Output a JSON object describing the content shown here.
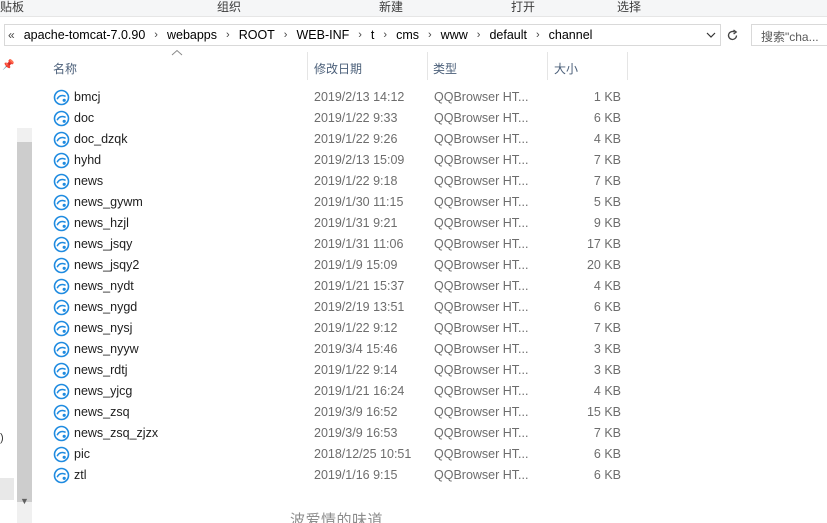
{
  "ribbon": {
    "groups": [
      "贴板",
      "组织",
      "新建",
      "打开",
      "选择"
    ]
  },
  "address": {
    "lead": "«",
    "crumbs": [
      "apache-tomcat-7.0.90",
      "webapps",
      "ROOT",
      "WEB-INF",
      "t",
      "cms",
      "www",
      "default",
      "channel"
    ]
  },
  "search": {
    "placeholder": "搜索\"cha..."
  },
  "nav": {
    "fragment": ")"
  },
  "columns": {
    "name": "名称",
    "date": "修改日期",
    "type": "类型",
    "size": "大小"
  },
  "files": [
    {
      "name": "bmcj",
      "date": "2019/2/13 14:12",
      "type": "QQBrowser HT...",
      "size": "1 KB"
    },
    {
      "name": "doc",
      "date": "2019/1/22 9:33",
      "type": "QQBrowser HT...",
      "size": "6 KB"
    },
    {
      "name": "doc_dzqk",
      "date": "2019/1/22 9:26",
      "type": "QQBrowser HT...",
      "size": "4 KB"
    },
    {
      "name": "hyhd",
      "date": "2019/2/13 15:09",
      "type": "QQBrowser HT...",
      "size": "7 KB"
    },
    {
      "name": "news",
      "date": "2019/1/22 9:18",
      "type": "QQBrowser HT...",
      "size": "7 KB"
    },
    {
      "name": "news_gywm",
      "date": "2019/1/30 11:15",
      "type": "QQBrowser HT...",
      "size": "5 KB"
    },
    {
      "name": "news_hzjl",
      "date": "2019/1/31 9:21",
      "type": "QQBrowser HT...",
      "size": "9 KB"
    },
    {
      "name": "news_jsqy",
      "date": "2019/1/31 11:06",
      "type": "QQBrowser HT...",
      "size": "17 KB"
    },
    {
      "name": "news_jsqy2",
      "date": "2019/1/9 15:09",
      "type": "QQBrowser HT...",
      "size": "20 KB"
    },
    {
      "name": "news_nydt",
      "date": "2019/1/21 15:37",
      "type": "QQBrowser HT...",
      "size": "4 KB"
    },
    {
      "name": "news_nygd",
      "date": "2019/2/19 13:51",
      "type": "QQBrowser HT...",
      "size": "6 KB"
    },
    {
      "name": "news_nysj",
      "date": "2019/1/22 9:12",
      "type": "QQBrowser HT...",
      "size": "7 KB"
    },
    {
      "name": "news_nyyw",
      "date": "2019/3/4 15:46",
      "type": "QQBrowser HT...",
      "size": "3 KB"
    },
    {
      "name": "news_rdtj",
      "date": "2019/1/22 9:14",
      "type": "QQBrowser HT...",
      "size": "3 KB"
    },
    {
      "name": "news_yjcg",
      "date": "2019/1/21 16:24",
      "type": "QQBrowser HT...",
      "size": "4 KB"
    },
    {
      "name": "news_zsq",
      "date": "2019/3/9 16:52",
      "type": "QQBrowser HT...",
      "size": "15 KB"
    },
    {
      "name": "news_zsq_zjzx",
      "date": "2019/3/9 16:53",
      "type": "QQBrowser HT...",
      "size": "7 KB"
    },
    {
      "name": "pic",
      "date": "2018/12/25 10:51",
      "type": "QQBrowser HT...",
      "size": "6 KB"
    },
    {
      "name": "ztl",
      "date": "2019/1/16 9:15",
      "type": "QQBrowser HT...",
      "size": "6 KB"
    }
  ],
  "file_icon": "qqbrowser-html-icon",
  "watermark": "波爱情的味道",
  "colors": {
    "header_text": "#4c607a",
    "icon_blue": "#1f8be0",
    "detail_text": "#6d6d6d"
  }
}
